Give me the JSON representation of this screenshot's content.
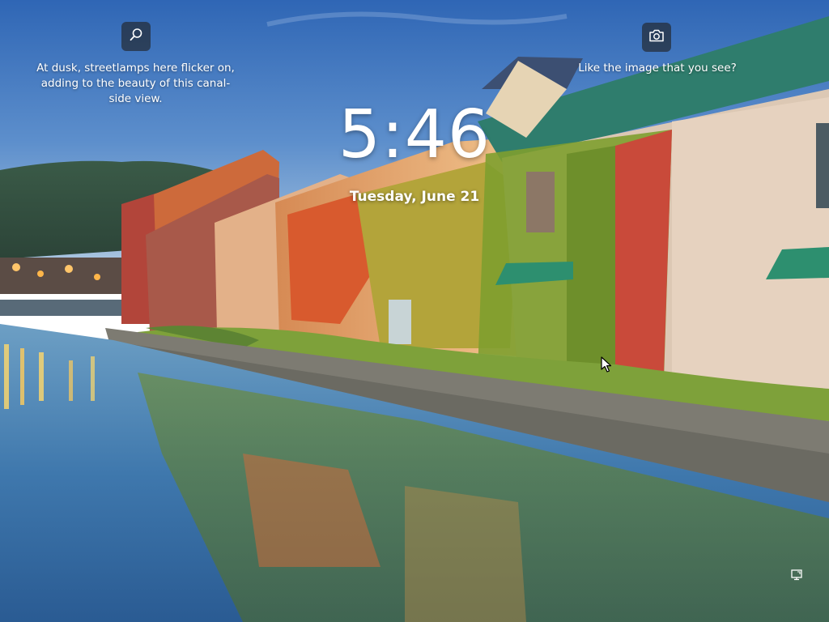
{
  "spotlight": {
    "fact_text": "At dusk, streetlamps here flicker on, adding to the beauty of this canal-side view.",
    "fact_icon": "search-icon",
    "like_text": "Like the image that you see?",
    "like_icon": "camera-icon"
  },
  "clock": {
    "time": "5:46",
    "date": "Tuesday, June 21"
  },
  "status": {
    "network_icon": "network-icon"
  }
}
